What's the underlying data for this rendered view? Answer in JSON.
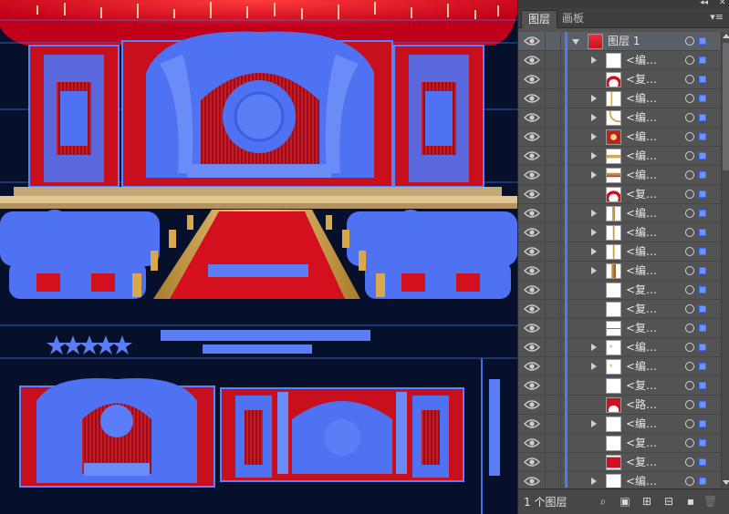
{
  "panel": {
    "collapse_glyph": "◂◂",
    "close_glyph": "✕",
    "tabs": [
      "图层",
      "画板"
    ],
    "active_tab": 0,
    "menu_glyph": "▾≡",
    "footer": {
      "layer_count": "1 个图层",
      "icons": [
        "search-icon",
        "make-clipping-mask-icon",
        "create-sublayer-icon",
        "create-new-layer-icon",
        "new-layer-icon",
        "delete-icon"
      ]
    }
  },
  "layers": [
    {
      "name": "图层 1",
      "type": "layer",
      "expanded": true,
      "thumb": "red-stage"
    },
    {
      "name": "<编…",
      "type": "group",
      "thumb": "frame-light"
    },
    {
      "name": "<复…",
      "type": "compound",
      "thumb": "arch-red"
    },
    {
      "name": "<编…",
      "type": "group",
      "thumb": "frame-gold"
    },
    {
      "name": "<编…",
      "type": "group",
      "thumb": "curve-gold"
    },
    {
      "name": "<编…",
      "type": "group",
      "thumb": "medallion"
    },
    {
      "name": "<编…",
      "type": "group",
      "thumb": "bar-gold"
    },
    {
      "name": "<编…",
      "type": "group",
      "thumb": "bench"
    },
    {
      "name": "<复…",
      "type": "compound",
      "thumb": "arch-red"
    },
    {
      "name": "<编…",
      "type": "group",
      "thumb": "column"
    },
    {
      "name": "<编…",
      "type": "group",
      "thumb": "column-thin"
    },
    {
      "name": "<编…",
      "type": "group",
      "thumb": "column-thin"
    },
    {
      "name": "<编…",
      "type": "group",
      "thumb": "column-wide"
    },
    {
      "name": "<复…",
      "type": "compound",
      "thumb": "blank"
    },
    {
      "name": "<复…",
      "type": "compound",
      "thumb": "blank"
    },
    {
      "name": "<复…",
      "type": "compound",
      "thumb": "line"
    },
    {
      "name": "<编…",
      "type": "group",
      "thumb": "dots"
    },
    {
      "name": "<编…",
      "type": "group",
      "thumb": "dots"
    },
    {
      "name": "<复…",
      "type": "compound",
      "thumb": "blank"
    },
    {
      "name": "<路…",
      "type": "path",
      "thumb": "arch-red-big"
    },
    {
      "name": "<编…",
      "type": "group",
      "thumb": "frame-light"
    },
    {
      "name": "<复…",
      "type": "compound",
      "thumb": "blank"
    },
    {
      "name": "<复…",
      "type": "compound",
      "thumb": "panel-red"
    },
    {
      "name": "<编…",
      "type": "group",
      "thumb": "frame-light"
    }
  ],
  "colors": {
    "canvas_bg": "#06102a",
    "selection": "#4d7df0",
    "stage_red": "#d4101e",
    "gold": "#d9a84a",
    "panel_bg": "#535353"
  }
}
